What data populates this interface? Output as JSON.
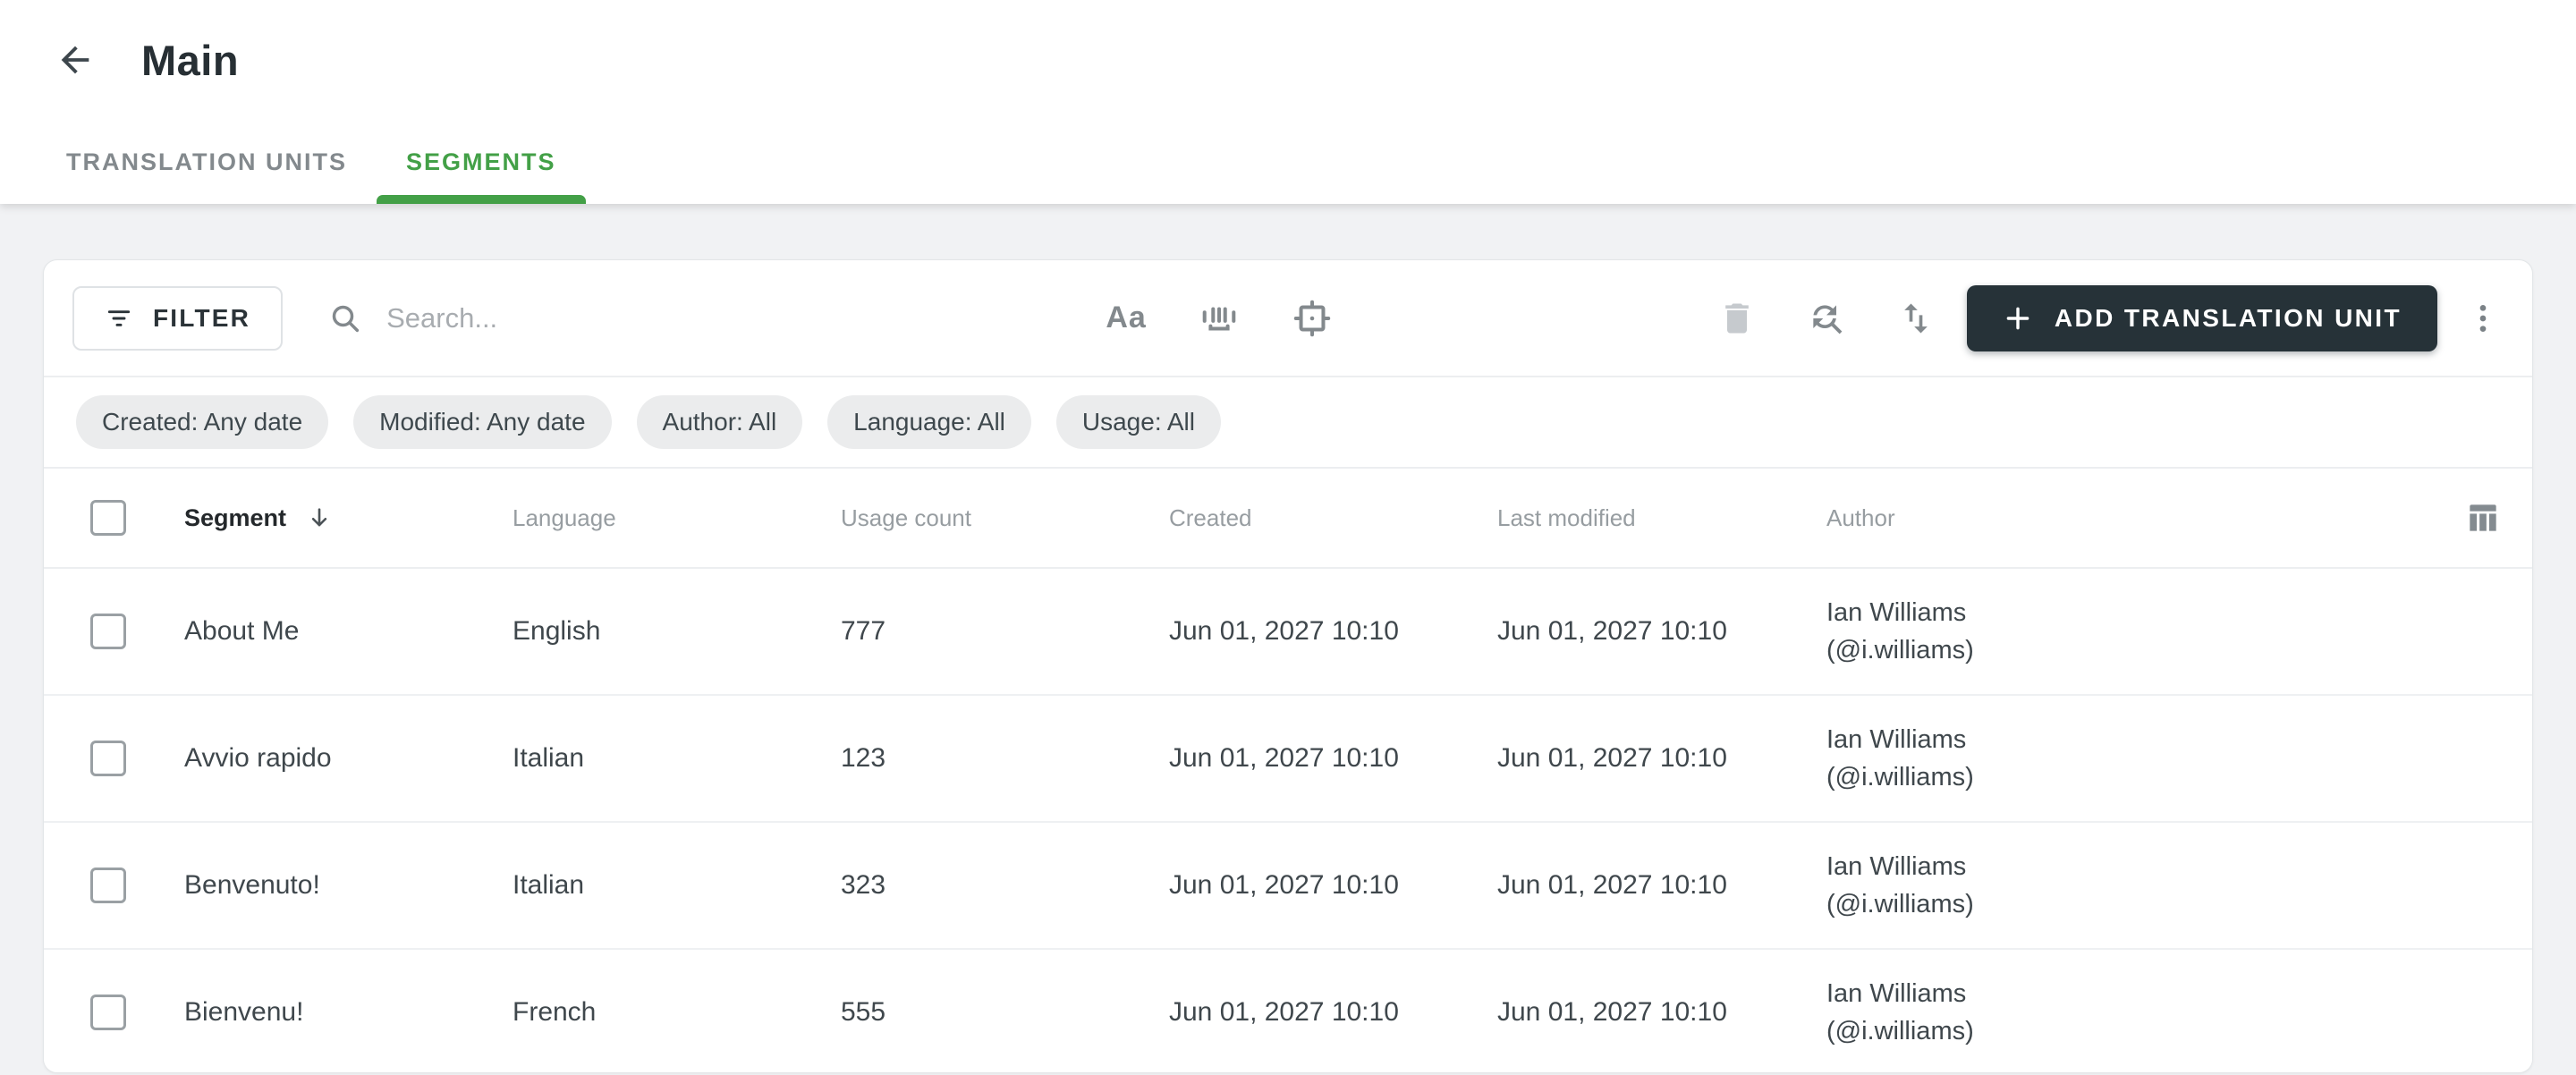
{
  "page": {
    "title": "Main"
  },
  "tabs": [
    {
      "label": "TRANSLATION UNITS"
    },
    {
      "label": "SEGMENTS"
    }
  ],
  "toolbar": {
    "filter_label": "FILTER",
    "search_placeholder": "Search...",
    "match_case_label": "Aa",
    "add_label": "ADD TRANSLATION UNIT"
  },
  "filter_chips": [
    {
      "label": "Created: Any date"
    },
    {
      "label": "Modified: Any date"
    },
    {
      "label": "Author: All"
    },
    {
      "label": "Language: All"
    },
    {
      "label": "Usage: All"
    }
  ],
  "table": {
    "columns": [
      "Segment",
      "Language",
      "Usage count",
      "Created",
      "Last modified",
      "Author"
    ],
    "rows": [
      {
        "segment": "About Me",
        "language": "English",
        "usage_count": "777",
        "created": "Jun 01, 2027 10:10",
        "last_modified": "Jun 01, 2027 10:10",
        "author_name": "Ian Williams",
        "author_handle": "(@i.williams)"
      },
      {
        "segment": "Avvio rapido",
        "language": "Italian",
        "usage_count": "123",
        "created": "Jun 01, 2027 10:10",
        "last_modified": "Jun 01, 2027 10:10",
        "author_name": "Ian Williams",
        "author_handle": "(@i.williams)"
      },
      {
        "segment": "Benvenuto!",
        "language": "Italian",
        "usage_count": "323",
        "created": "Jun 01, 2027 10:10",
        "last_modified": "Jun 01, 2027 10:10",
        "author_name": "Ian Williams",
        "author_handle": "(@i.williams)"
      },
      {
        "segment": "Bienvenu!",
        "language": "French",
        "usage_count": "555",
        "created": "Jun 01, 2027 10:10",
        "last_modified": "Jun 01, 2027 10:10",
        "author_name": "Ian Williams",
        "author_handle": "(@i.williams)"
      }
    ]
  },
  "colors": {
    "accent_green": "#43a047",
    "primary_dark": "#263238",
    "page_background": "#f1f2f4"
  }
}
